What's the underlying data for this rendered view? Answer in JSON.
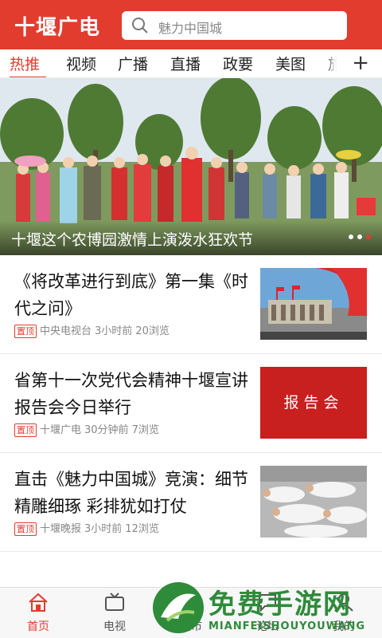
{
  "header": {
    "logo": "十堰广电",
    "search_placeholder": "魅力中国城"
  },
  "tabs": [
    "热推",
    "视频",
    "广播",
    "直播",
    "政要",
    "美图",
    "旅"
  ],
  "banner": {
    "caption": "十堰这个农博园激情上演泼水狂欢节"
  },
  "news": [
    {
      "title": "《将改革进行到底》第一集《时代之问》",
      "badge": "置顶",
      "source": "中央电视台",
      "time": "3小时前",
      "views": "20浏览"
    },
    {
      "title": "省第十一次党代会精神十堰宣讲报告会今日举行",
      "badge": "置顶",
      "source": "十堰广电",
      "time": "30分钟前",
      "views": "7浏览",
      "thumb_text": "报告会"
    },
    {
      "title": "直击《魅力中国城》竞演：细节精雕细琢 彩排犹如打仗",
      "badge": "置顶",
      "source": "十堰晚报",
      "time": "3小时前",
      "views": "12浏览"
    }
  ],
  "bottom_nav": [
    {
      "label": "首页",
      "icon": "home-icon"
    },
    {
      "label": "电视",
      "icon": "tv-icon"
    },
    {
      "label": "城市",
      "icon": "city-icon"
    },
    {
      "label": "论坛",
      "icon": "forum-icon"
    },
    {
      "label": "我的",
      "icon": "user-icon"
    }
  ],
  "watermark": {
    "title": "免费手游网",
    "subtitle": "MIANFEISHOUYOUWANG"
  },
  "colors": {
    "accent": "#e23c2e",
    "watermark": "#2e8b3a"
  }
}
